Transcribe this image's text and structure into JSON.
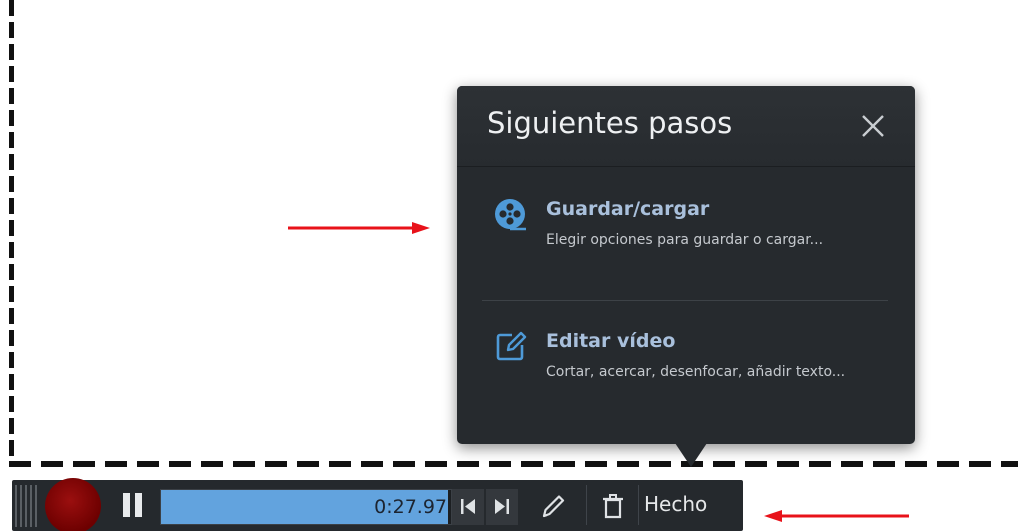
{
  "popup": {
    "title": "Siguientes pasos",
    "close_icon": "close-icon",
    "items": [
      {
        "icon": "film-reel-icon",
        "title": "Guardar/cargar",
        "description": "Elegir opciones para guardar o cargar..."
      },
      {
        "icon": "edit-pencil-square-icon",
        "title": "Editar vídeo",
        "description": "Cortar, acercar, desenfocar, añadir texto..."
      }
    ]
  },
  "toolbar": {
    "record_icon": "record-icon",
    "pause_icon": "pause-icon",
    "elapsed_time": "0:27.97",
    "progress_fraction": 0.99,
    "prev_icon": "skip-back-icon",
    "next_icon": "skip-forward-icon",
    "pencil_icon": "pencil-icon",
    "trash_icon": "trash-icon",
    "done_label": "Hecho"
  },
  "colors": {
    "popup_bg": "#262a2e",
    "accent_blue": "#62a3de",
    "item_title": "#a9c0dc",
    "record_red": "#8b0a0a",
    "annotation_arrow": "#e8121a"
  }
}
